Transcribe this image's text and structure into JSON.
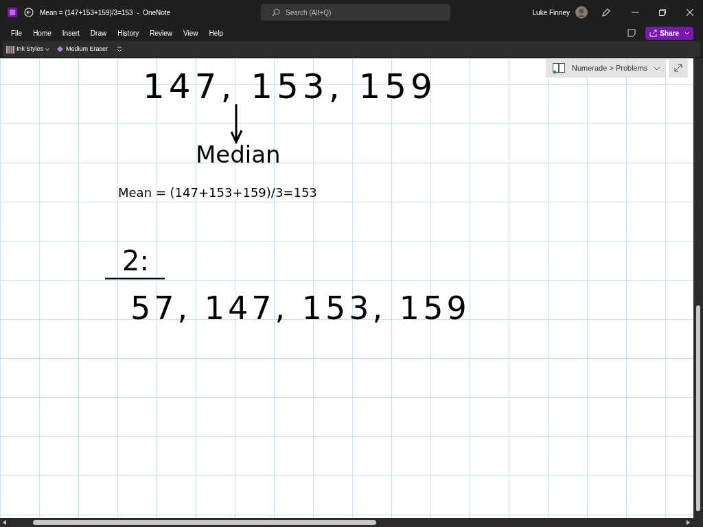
{
  "window": {
    "title": "Mean = (147+153+159)/3=153  -  OneNote",
    "user": "Luke Finney"
  },
  "search": {
    "placeholder": "Search (Alt+Q)"
  },
  "menu": [
    "File",
    "Home",
    "Insert",
    "Draw",
    "History",
    "Review",
    "View",
    "Help"
  ],
  "share_button": "Share",
  "toolbar": [
    {
      "kind": "ink",
      "label": "Ink Styles"
    },
    {
      "kind": "eraser",
      "label": "Medium Eraser"
    }
  ],
  "notebook": {
    "breadcrumb": "Numerade > Problems"
  },
  "page": {
    "ink_line_1": "147, 153, 159",
    "ink_label": "Median",
    "typed_text": "Mean = (147+153+159)/3=153",
    "ink_heading": "2:",
    "ink_line_2": "57, 147, 153, 159"
  }
}
